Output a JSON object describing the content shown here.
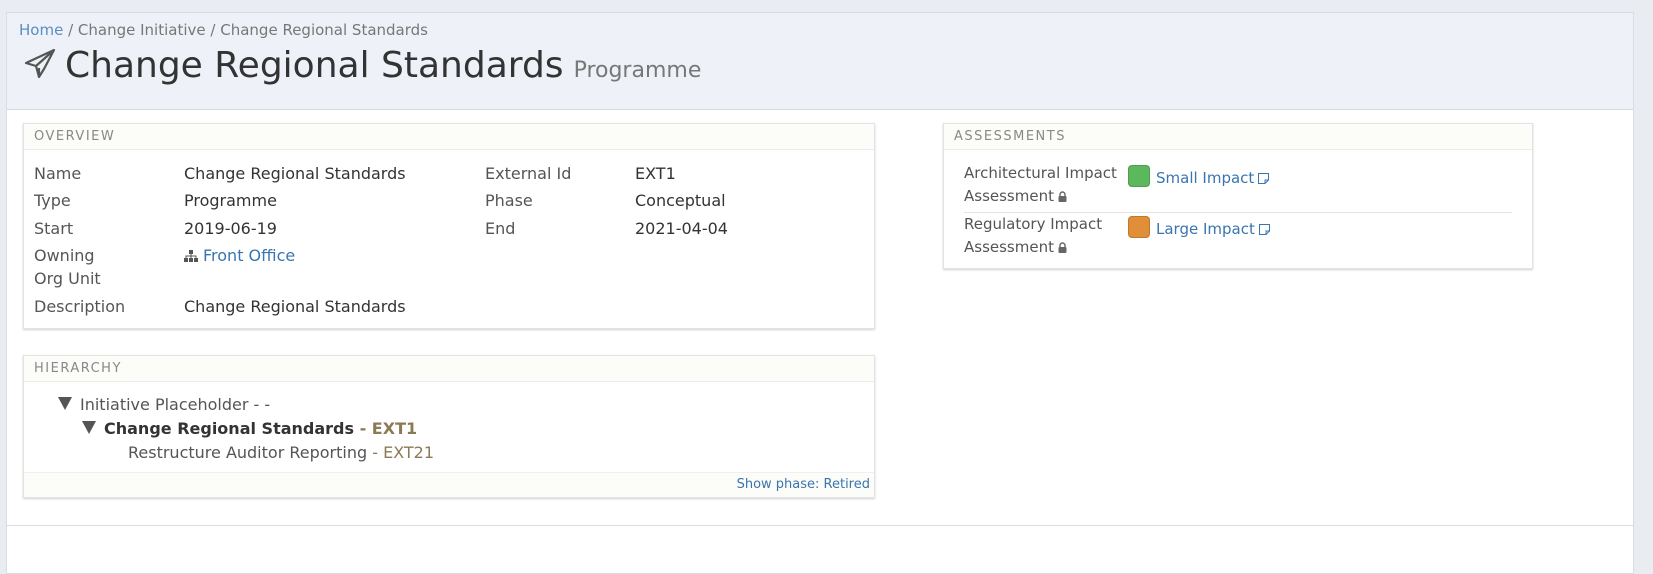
{
  "breadcrumb": {
    "home": "Home",
    "sep1": "/",
    "parent": "Change Initiative",
    "sep2": "/",
    "current": "Change Regional Standards"
  },
  "header": {
    "icon": "paper-plane-icon",
    "title": "Change Regional Standards",
    "subtitle": "Programme"
  },
  "overview": {
    "heading": "OVERVIEW",
    "name_label": "Name",
    "name_value": "Change Regional Standards",
    "type_label": "Type",
    "type_value": "Programme",
    "start_label": "Start",
    "start_value": "2019-06-19",
    "owning_label_1": "Owning",
    "owning_label_2": "Org Unit",
    "owning_value": "Front Office",
    "description_label": "Description",
    "description_value": "Change Regional Standards",
    "external_id_label": "External Id",
    "external_id_value": "EXT1",
    "phase_label": "Phase",
    "phase_value": "Conceptual",
    "end_label": "End",
    "end_value": "2021-04-04"
  },
  "hierarchy": {
    "heading": "HIERARCHY",
    "items": [
      {
        "name": "Initiative Placeholder",
        "sep": " - ",
        "ext": "-"
      },
      {
        "name": "Change Regional Standards",
        "sep": " - ",
        "ext": "EXT1"
      },
      {
        "name": "Restructure Auditor Reporting",
        "sep": " - ",
        "ext": "EXT21"
      }
    ],
    "footer_link": "Show phase: Retired"
  },
  "assessments": {
    "heading": "ASSESSMENTS",
    "items": [
      {
        "label_1": "Architectural Impact",
        "label_2": "Assessment",
        "value": "Small Impact",
        "color": "#5cb85c"
      },
      {
        "label_1": "Regulatory Impact",
        "label_2": "Assessment",
        "value": "Large Impact",
        "color": "#e08e38"
      }
    ]
  }
}
